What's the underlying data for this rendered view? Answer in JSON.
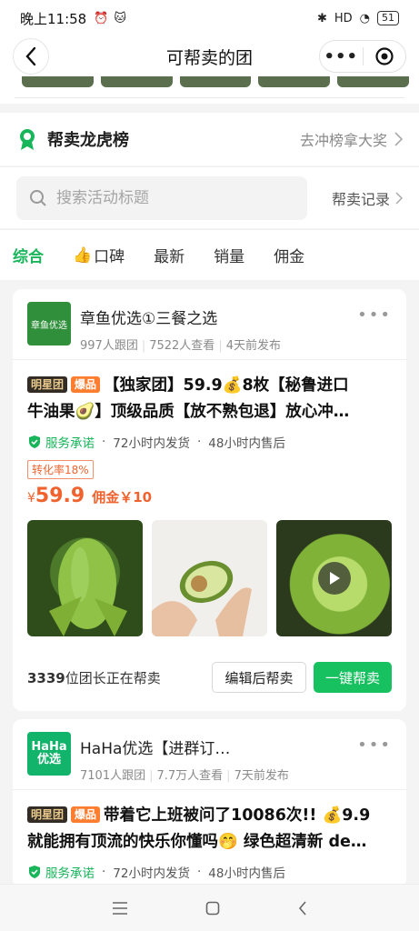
{
  "status": {
    "time": "晚上11:58",
    "network": "HD",
    "battery": "51"
  },
  "nav": {
    "title": "可帮卖的团"
  },
  "rank": {
    "title": "帮卖龙虎榜",
    "link": "去冲榜拿大奖"
  },
  "search": {
    "placeholder": "搜索活动标题",
    "records": "帮卖记录"
  },
  "tabs": [
    {
      "label": "综合"
    },
    {
      "label": "口碑",
      "icon": "thumbs-up-icon"
    },
    {
      "label": "最新"
    },
    {
      "label": "销量"
    },
    {
      "label": "佣金"
    }
  ],
  "cards": [
    {
      "logo_text": "章鱼优选",
      "store_name": "章鱼优选①三餐之选",
      "followers": "997人跟团",
      "views": "7522人查看",
      "posted": "4天前发布",
      "tag_star": "明星团",
      "tag_hot": "爆品",
      "title_line1": "【独家团】59.9💰8枚【秘鲁进口",
      "title_line2": "牛油果🥑】顶级品质【放不熟包退】放心冲…",
      "service": "服务承诺",
      "ship": "72小时内发货",
      "after_sale": "48小时内售后",
      "conversion": "转化率18%",
      "price_symbol": "¥",
      "price": "59.9",
      "commission": "佣金￥10",
      "leaders_count": "3339",
      "leaders_text": "位团长正在帮卖",
      "edit_button": "编辑后帮卖",
      "help_button": "一键帮卖"
    },
    {
      "logo_text": "HaHa优选",
      "store_name": "HaHa优选【进群订…",
      "followers": "7101人跟团",
      "views": "7.7万人查看",
      "posted": "7天前发布",
      "tag_star": "明星团",
      "tag_hot": "爆品",
      "title_line1": "带着它上班被问了10086次!! 💰9.9",
      "title_line2": "就能拥有顶流的快乐你懂吗🤭 绿色超清新 de…",
      "service": "服务承诺",
      "ship": "72小时内发货",
      "after_sale": "48小时内售后"
    }
  ],
  "colors": {
    "brand_green": "#18c160",
    "price_orange": "#f0632e"
  }
}
